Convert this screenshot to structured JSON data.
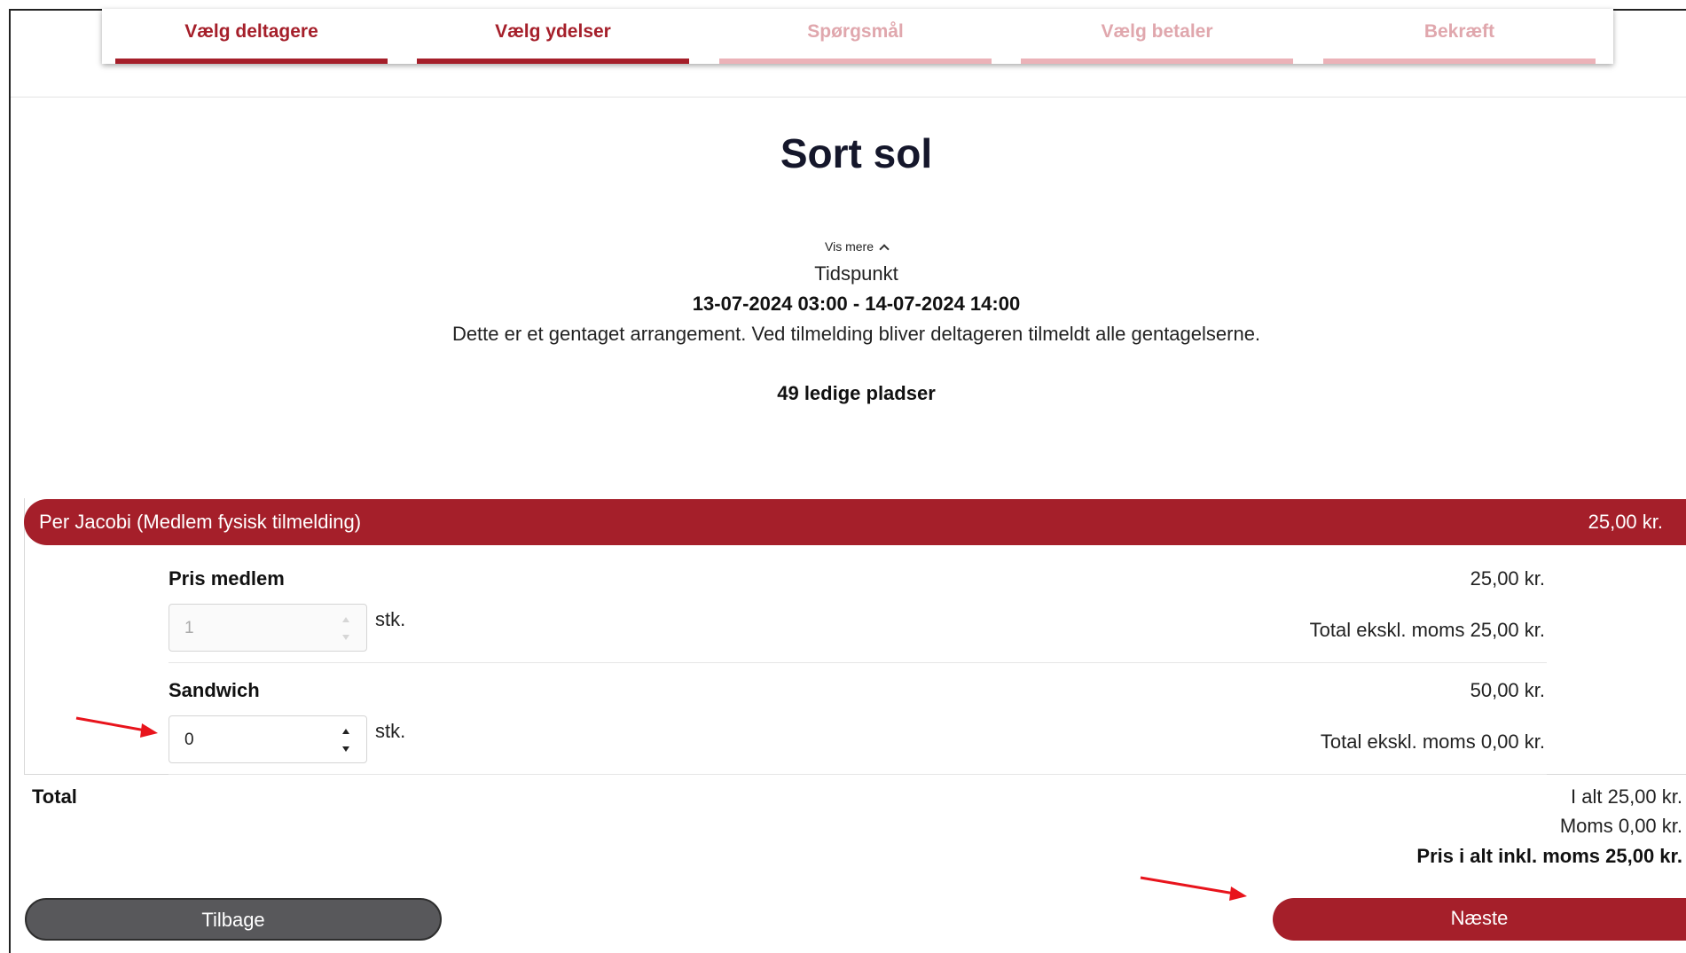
{
  "steps": [
    {
      "label": "Vælg deltagere",
      "state": "active"
    },
    {
      "label": "Vælg ydelser",
      "state": "active"
    },
    {
      "label": "Spørgsmål",
      "state": "inactive"
    },
    {
      "label": "Vælg betaler",
      "state": "inactive"
    },
    {
      "label": "Bekræft",
      "state": "inactive"
    }
  ],
  "event": {
    "title": "Sort sol",
    "vis_mere": "Vis mere",
    "tidspunkt_label": "Tidspunkt",
    "tidspunkt_value": "13-07-2024 03:00 - 14-07-2024 14:00",
    "info": "Dette er et gentaget arrangement. Ved tilmelding bliver deltageren tilmeldt alle gentagelserne.",
    "seats": "49 ledige pladser"
  },
  "participant": {
    "name": "Per Jacobi (Medlem fysisk tilmelding)",
    "price": "25,00 kr.",
    "items": [
      {
        "name": "Pris medlem",
        "price": "25,00 kr.",
        "qty": "1",
        "unit": "stk.",
        "total": "Total ekskl. moms 25,00 kr.",
        "disabled": true
      },
      {
        "name": "Sandwich",
        "price": "50,00 kr.",
        "qty": "0",
        "unit": "stk.",
        "total": "Total ekskl. moms 0,00 kr.",
        "disabled": false
      }
    ]
  },
  "summary": {
    "total_label": "Total",
    "i_alt": "I alt 25,00 kr.",
    "moms": "Moms 0,00 kr.",
    "pris_i_alt": "Pris i alt inkl. moms 25,00 kr."
  },
  "buttons": {
    "back": "Tilbage",
    "next": "Næste"
  },
  "colors": {
    "brand": "#a51f2a",
    "step_inactive": "#ebb2b8",
    "back_button": "#58585b",
    "annotation_arrow": "#e8141c"
  },
  "icons": {
    "expand": "chevron-up-icon",
    "spinner_up": "caret-up-icon",
    "spinner_down": "caret-down-icon",
    "annotation": "arrow-icon"
  }
}
